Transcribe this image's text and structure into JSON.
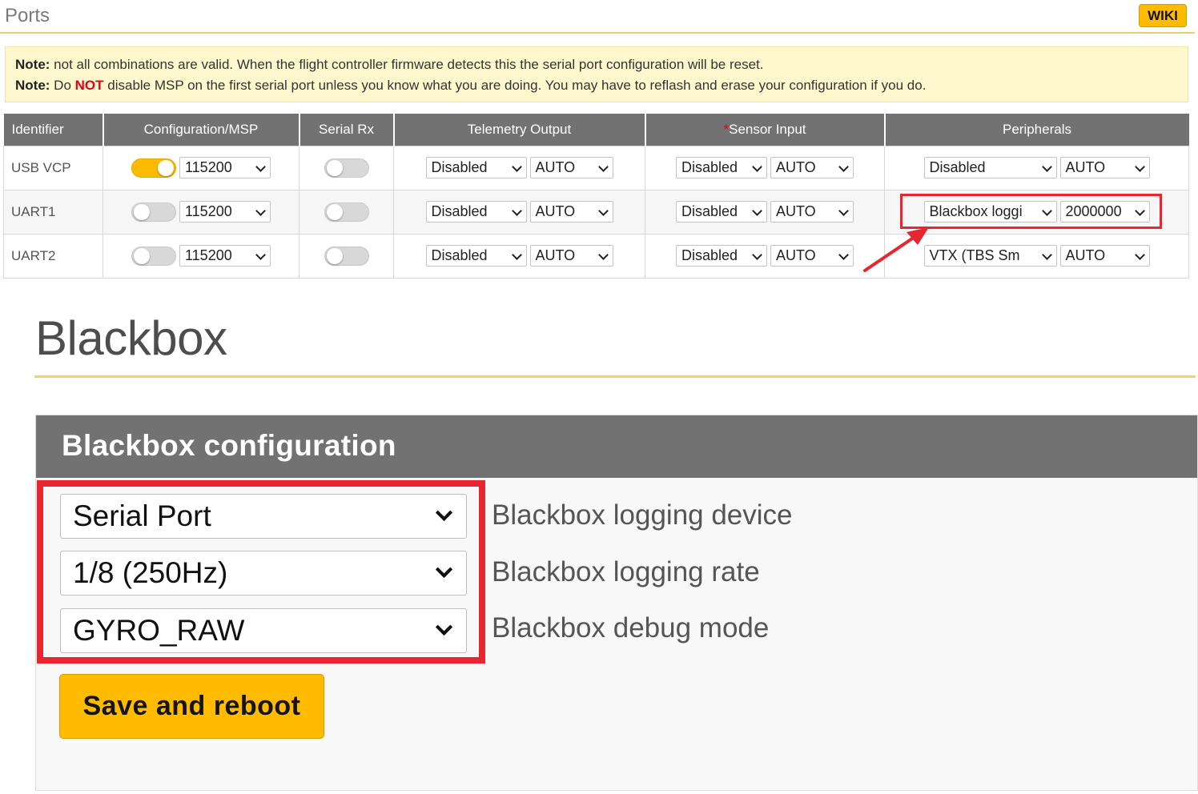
{
  "ports": {
    "title": "Ports",
    "wiki_label": "WIKI",
    "note": {
      "line1_label": "Note:",
      "line1_text": " not all combinations are valid. When the flight controller firmware detects this the serial port configuration will be reset.",
      "line2_label": "Note:",
      "line2_pre": " Do ",
      "line2_not": "NOT",
      "line2_post": " disable MSP on the first serial port unless you know what you are doing. You may have to reflash and erase your configuration if you do."
    },
    "columns": {
      "identifier": "Identifier",
      "config_msp": "Configuration/MSP",
      "serial_rx": "Serial Rx",
      "telemetry": "Telemetry Output",
      "sensor_star": "*",
      "sensor": "Sensor Input",
      "peripherals": "Peripherals"
    },
    "rows": [
      {
        "identifier": "USB VCP",
        "msp_on": true,
        "msp_baud": "115200",
        "serial_rx_on": false,
        "telemetry_type": "Disabled",
        "telemetry_baud": "AUTO",
        "sensor_type": "Disabled",
        "sensor_baud": "AUTO",
        "peripheral_type": "Disabled",
        "peripheral_baud": "AUTO"
      },
      {
        "identifier": "UART1",
        "msp_on": false,
        "msp_baud": "115200",
        "serial_rx_on": false,
        "telemetry_type": "Disabled",
        "telemetry_baud": "AUTO",
        "sensor_type": "Disabled",
        "sensor_baud": "AUTO",
        "peripheral_type": "Blackbox loggi",
        "peripheral_baud": "2000000"
      },
      {
        "identifier": "UART2",
        "msp_on": false,
        "msp_baud": "115200",
        "serial_rx_on": false,
        "telemetry_type": "Disabled",
        "telemetry_baud": "AUTO",
        "sensor_type": "Disabled",
        "sensor_baud": "AUTO",
        "peripheral_type": "VTX (TBS Sm",
        "peripheral_baud": "AUTO"
      }
    ]
  },
  "blackbox": {
    "title": "Blackbox",
    "panel_title": "Blackbox configuration",
    "device_value": "Serial Port",
    "device_label": "Blackbox logging device",
    "rate_value": "1/8 (250Hz)",
    "rate_label": "Blackbox logging rate",
    "debug_value": "GYRO_RAW",
    "debug_label": "Blackbox debug mode",
    "save_label": "Save and reboot"
  },
  "colors": {
    "accent": "#ffbb00",
    "header_gray": "#727272",
    "highlight_red": "#e8262f",
    "note_bg": "#fff8cf"
  }
}
